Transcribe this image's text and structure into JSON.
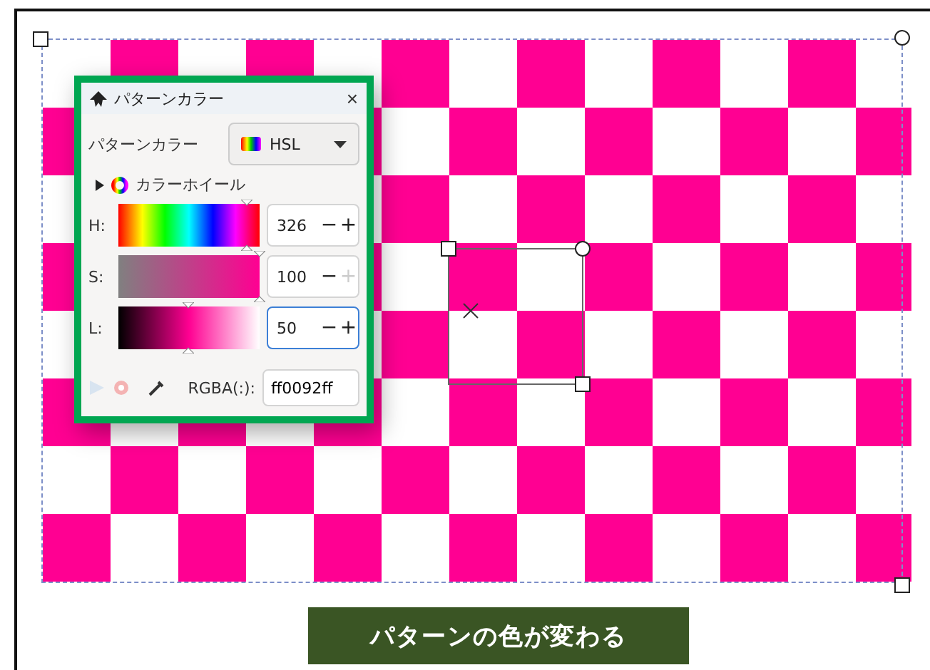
{
  "dialog": {
    "title": "パターンカラー",
    "close": "×",
    "mode_label": "パターンカラー",
    "mode": "HSL",
    "wheel": {
      "label": "カラーホイール",
      "expanded": false
    },
    "sliders": [
      {
        "kind": "hue",
        "label": "H:",
        "level": 0.906,
        "value": "326",
        "focused": false,
        "plus_disabled": false
      },
      {
        "kind": "saturation",
        "label": "S:",
        "level": 1,
        "value": "100",
        "focused": false,
        "plus_disabled": true
      },
      {
        "kind": "lightness",
        "label": "L:",
        "level": 0.5,
        "value": "50",
        "focused": true,
        "plus_disabled": false
      }
    ],
    "minus": "−",
    "plus": "+",
    "rgba_label": "RGBA(:):",
    "rgba_value": "ff0092ff"
  },
  "caption": "パターンの色が変わる"
}
